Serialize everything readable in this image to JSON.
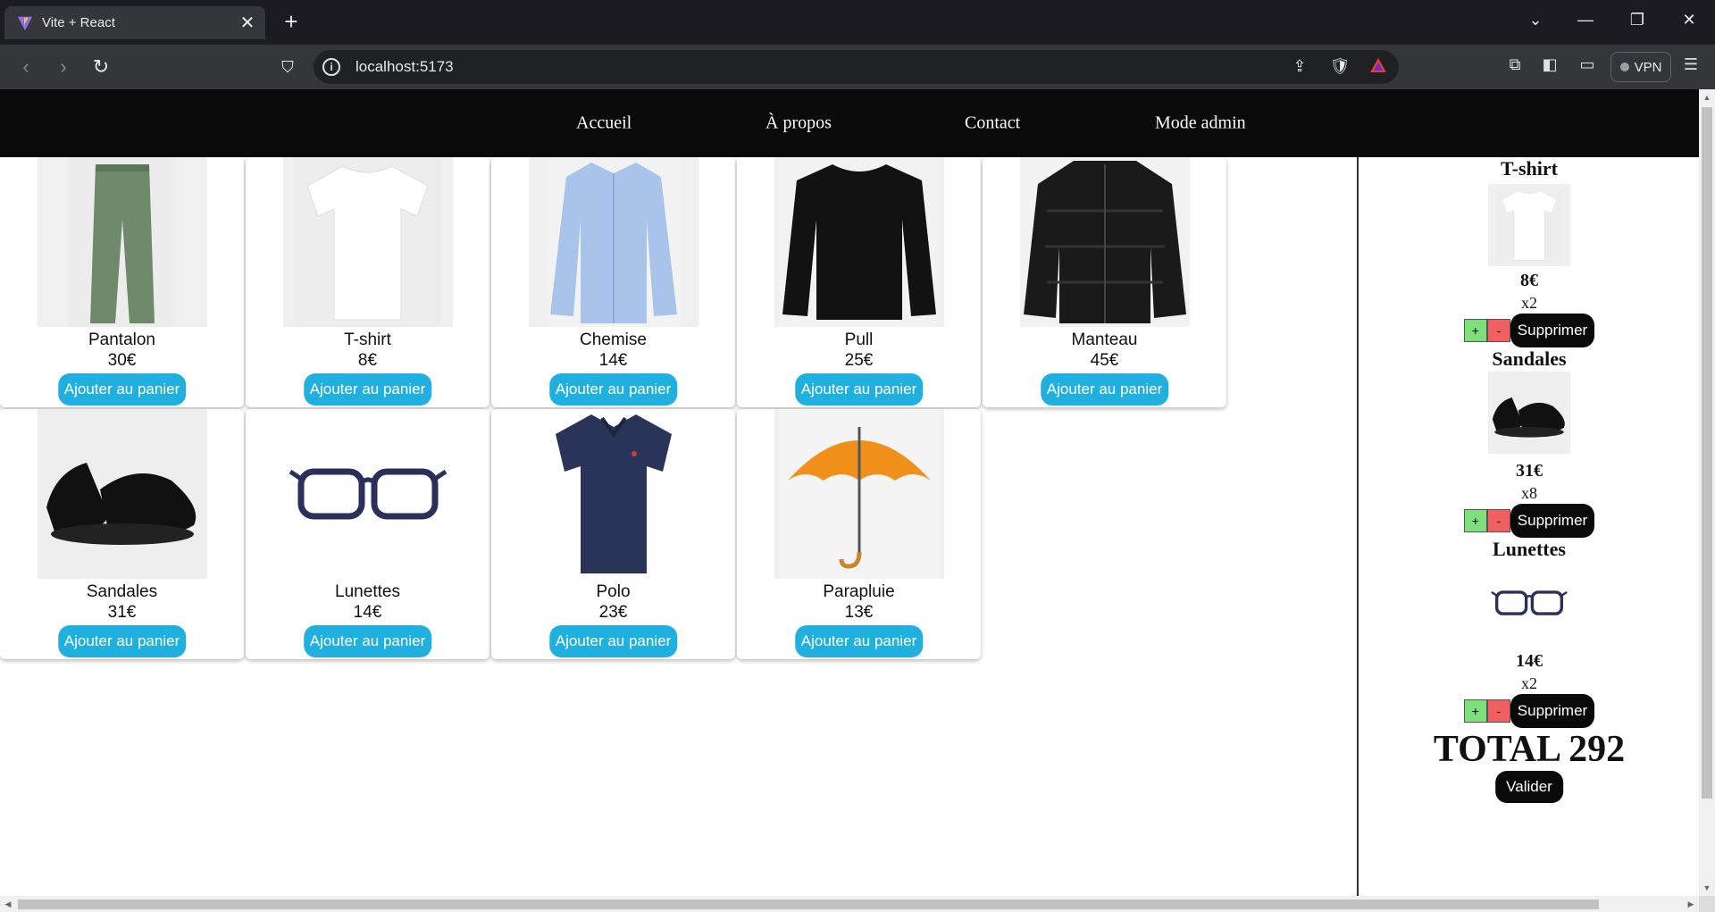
{
  "browser": {
    "tab_title": "Vite + React",
    "url": "localhost:5173",
    "vpn_label": "VPN",
    "icons": {
      "back": "arrow-left-icon",
      "forward": "arrow-right-icon",
      "reload": "reload-icon",
      "bookmark": "bookmark-icon",
      "share": "share-icon",
      "brave": "brave-shield-icon",
      "rewards": "brave-rewards-icon",
      "extensions": "extensions-icon",
      "sidebar": "sidebar-icon",
      "wallet": "wallet-icon",
      "menu": "hamburger-menu-icon"
    }
  },
  "site_nav": {
    "links": [
      "Accueil",
      "À propos",
      "Contact",
      "Mode admin"
    ]
  },
  "products": [
    {
      "name": "Pantalon",
      "price": "30€",
      "button": "Ajouter au panier",
      "icon": "pants-icon",
      "color": "#6f8a6a"
    },
    {
      "name": "T-shirt",
      "price": "8€",
      "button": "Ajouter au panier",
      "icon": "tshirt-icon",
      "color": "#ffffff"
    },
    {
      "name": "Chemise",
      "price": "14€",
      "button": "Ajouter au panier",
      "icon": "shirt-icon",
      "color": "#a9c4ea"
    },
    {
      "name": "Pull",
      "price": "25€",
      "button": "Ajouter au panier",
      "icon": "sweater-icon",
      "color": "#121212"
    },
    {
      "name": "Manteau",
      "price": "45€",
      "button": "Ajouter au panier",
      "icon": "jacket-icon",
      "color": "#1a1a1a"
    },
    {
      "name": "Sandales",
      "price": "31€",
      "button": "Ajouter au panier",
      "icon": "sandals-icon",
      "color": "#111111"
    },
    {
      "name": "Lunettes",
      "price": "14€",
      "button": "Ajouter au panier",
      "icon": "glasses-icon",
      "color": "#2c2f5a"
    },
    {
      "name": "Polo",
      "price": "23€",
      "button": "Ajouter au panier",
      "icon": "polo-icon",
      "color": "#2a3358"
    },
    {
      "name": "Parapluie",
      "price": "13€",
      "button": "Ajouter au panier",
      "icon": "umbrella-icon",
      "color": "#f0901a"
    }
  ],
  "cart": {
    "items": [
      {
        "name": "T-shirt",
        "price": "8€",
        "qty": "x2",
        "plus": "+",
        "minus": "-",
        "delete": "Supprimer",
        "icon": "tshirt-icon"
      },
      {
        "name": "Sandales",
        "price": "31€",
        "qty": "x8",
        "plus": "+",
        "minus": "-",
        "delete": "Supprimer",
        "icon": "sandals-icon"
      },
      {
        "name": "Lunettes",
        "price": "14€",
        "qty": "x2",
        "plus": "+",
        "minus": "-",
        "delete": "Supprimer",
        "icon": "glasses-icon"
      }
    ],
    "total": "TOTAL 292",
    "validate": "Valider"
  },
  "colors": {
    "accent_button": "#1fb0e0",
    "dark": "#0a0a0a",
    "plus": "#7ee07a",
    "minus": "#f06060"
  }
}
